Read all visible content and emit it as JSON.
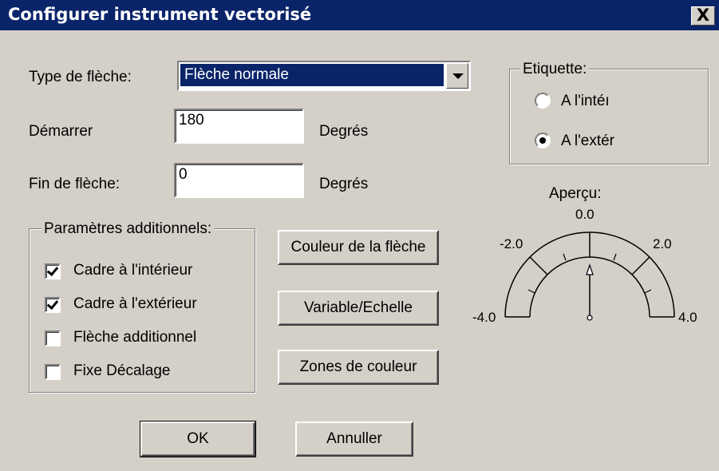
{
  "window": {
    "title": "Configurer instrument vectorisé",
    "close_label": "X"
  },
  "form": {
    "arrow_type_label": "Type de flèche:",
    "arrow_type_value": "Flèche normale",
    "start_label": "Démarrer",
    "start_value": "180",
    "start_unit": "Degrés",
    "end_label": "Fin de flèche:",
    "end_value": "0",
    "end_unit": "Degrés"
  },
  "label_group": {
    "legend": "Etiquette:",
    "options": [
      {
        "label": "A l'intéı",
        "selected": false
      },
      {
        "label": "A l'extér",
        "selected": true
      }
    ]
  },
  "additional_params": {
    "legend": "Paramètres additionnels:",
    "checkboxes": [
      {
        "label": "Cadre à l'intérieur",
        "checked": true
      },
      {
        "label": "Cadre à l'extérieur",
        "checked": true
      },
      {
        "label": "Flèche additionnel",
        "checked": false
      },
      {
        "label": "Fixe Décalage",
        "checked": false
      }
    ]
  },
  "side_buttons": {
    "arrow_color": "Couleur de la flèche",
    "variable_scale": "Variable/Echelle",
    "color_zones": "Zones de couleur"
  },
  "preview": {
    "label": "Aperçu:",
    "ticks": {
      "top": "0.0",
      "left_upper": "-2.0",
      "right_upper": "2.0",
      "left": "-4.0",
      "right": "4.0"
    }
  },
  "footer": {
    "ok": "OK",
    "cancel": "Annuller"
  },
  "colors": {
    "title_bar": "#0a246a",
    "dialog_face": "#d4d0c8",
    "selection": "#0a246a"
  }
}
